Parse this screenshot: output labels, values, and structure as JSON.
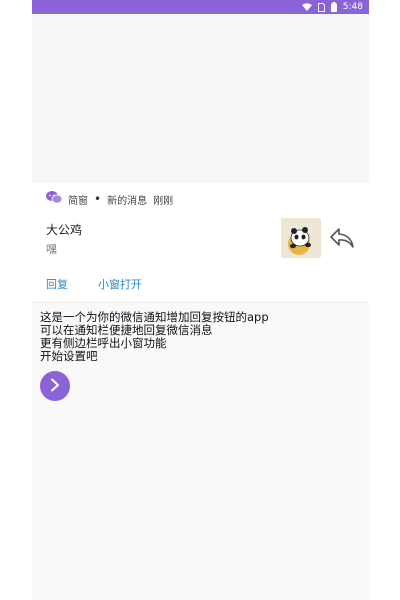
{
  "status_bar": {
    "time": "5:48",
    "icons": [
      "wifi-icon",
      "sim-icon",
      "battery-icon"
    ],
    "color": "#8a63d6"
  },
  "notification": {
    "app_name": "简窗",
    "separator": "•",
    "subtitle": "新的消息",
    "time": "刚刚",
    "sender": "大公鸡",
    "message": "嘿",
    "actions": {
      "reply": "回复",
      "open_small_window": "小窗打开"
    },
    "action_color": "#2f86c8"
  },
  "intro": {
    "lines": [
      "这是一个为你的微信通知增加回复按钮的app",
      "可以在通知栏便捷地回复微信消息",
      "更有侧边栏呼出小窗功能",
      "开始设置吧"
    ],
    "next_button_icon": "chevron-right-icon",
    "accent": "#8a63d6"
  }
}
